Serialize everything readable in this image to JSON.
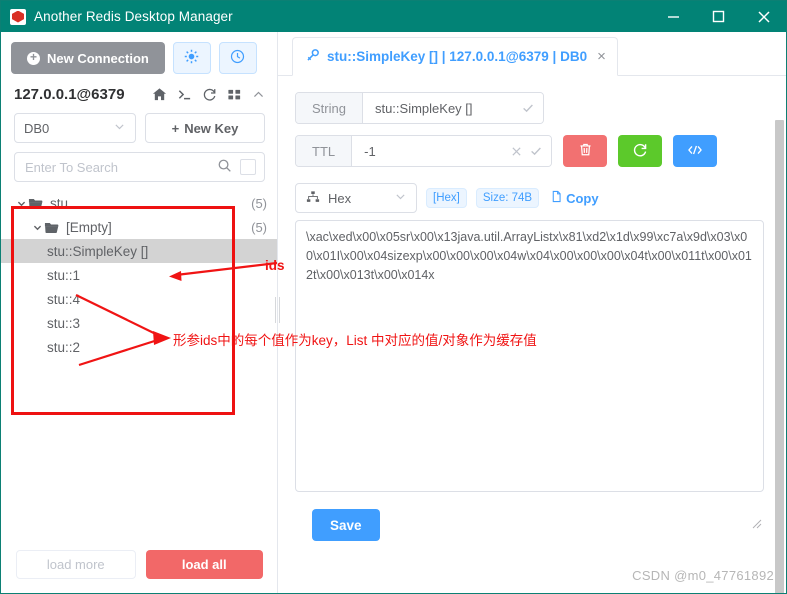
{
  "window": {
    "title": "Another Redis Desktop Manager",
    "logo_icon": "redis-logo-icon",
    "controls": {
      "minimize": "minimize-icon",
      "maximize": "maximize-icon",
      "close": "close-icon"
    },
    "titlebar_color": "#028376"
  },
  "sidebar": {
    "new_connection_label": "New Connection",
    "settings_icon": "gear-icon",
    "history_icon": "clock-icon",
    "connection": {
      "name": "127.0.0.1@6379",
      "icons": [
        "home-icon",
        "terminal-icon",
        "refresh-icon",
        "grid-icon",
        "chevron-up-icon"
      ]
    },
    "db_select": {
      "value": "DB0",
      "chevron": "chevron-down-icon"
    },
    "new_key_label": "New Key",
    "search": {
      "placeholder": "Enter To Search",
      "value": "",
      "icon": "search-icon",
      "checkbox_checked": false
    },
    "tree": [
      {
        "label": "stu",
        "count": "(5)",
        "type": "folder",
        "depth": 0,
        "expanded": true,
        "selected": false
      },
      {
        "label": "[Empty]",
        "count": "(5)",
        "type": "folder",
        "depth": 1,
        "expanded": true,
        "selected": false
      },
      {
        "label": "stu::SimpleKey []",
        "count": "",
        "type": "key",
        "depth": 2,
        "expanded": false,
        "selected": true
      },
      {
        "label": "stu::1",
        "count": "",
        "type": "key",
        "depth": 2,
        "expanded": false,
        "selected": false
      },
      {
        "label": "stu::4",
        "count": "",
        "type": "key",
        "depth": 2,
        "expanded": false,
        "selected": false
      },
      {
        "label": "stu::3",
        "count": "",
        "type": "key",
        "depth": 2,
        "expanded": false,
        "selected": false
      },
      {
        "label": "stu::2",
        "count": "",
        "type": "key",
        "depth": 2,
        "expanded": false,
        "selected": false
      }
    ],
    "load_more_label": "load more",
    "load_all_label": "load all"
  },
  "main": {
    "tab": {
      "icon": "key-icon",
      "label": "stu::SimpleKey [] | 127.0.0.1@6379 | DB0",
      "close": "×"
    },
    "key_type_label": "String",
    "key_name_value": "stu::SimpleKey []",
    "key_name_confirm_icon": "check-icon",
    "ttl_label": "TTL",
    "ttl_value": "-1",
    "ttl_clear_icon": "close-icon",
    "ttl_confirm_icon": "check-icon",
    "delete_icon": "trash-icon",
    "refresh_icon": "refresh-icon",
    "code_icon": "code-icon",
    "delete_color": "#f27171",
    "refresh_color": "#5cc92b",
    "code_color": "#409eff",
    "format": {
      "icon": "hierarchy-icon",
      "value": "Hex",
      "chevron": "chevron-down-icon",
      "badge_format": "[Hex]",
      "badge_size": "Size: 74B",
      "copy_label": "Copy",
      "copy_icon": "document-icon"
    },
    "value_text": "\\xac\\xed\\x00\\x05sr\\x00\\x13java.util.ArrayListx\\x81\\xd2\\x1d\\x99\\xc7a\\x9d\\x03\\x00\\x01I\\x00\\x04sizexp\\x00\\x00\\x00\\x04w\\x04\\x00\\x00\\x00\\x04t\\x00\\x011t\\x00\\x012t\\x00\\x013t\\x00\\x014x",
    "save_label": "Save"
  },
  "annotations": {
    "box_color": "#ee1111",
    "ids_label": "ids",
    "description": "形参ids中的每个值作为key，List 中对应的值/对象作为缓存值"
  },
  "watermark": "CSDN @m0_47761892"
}
